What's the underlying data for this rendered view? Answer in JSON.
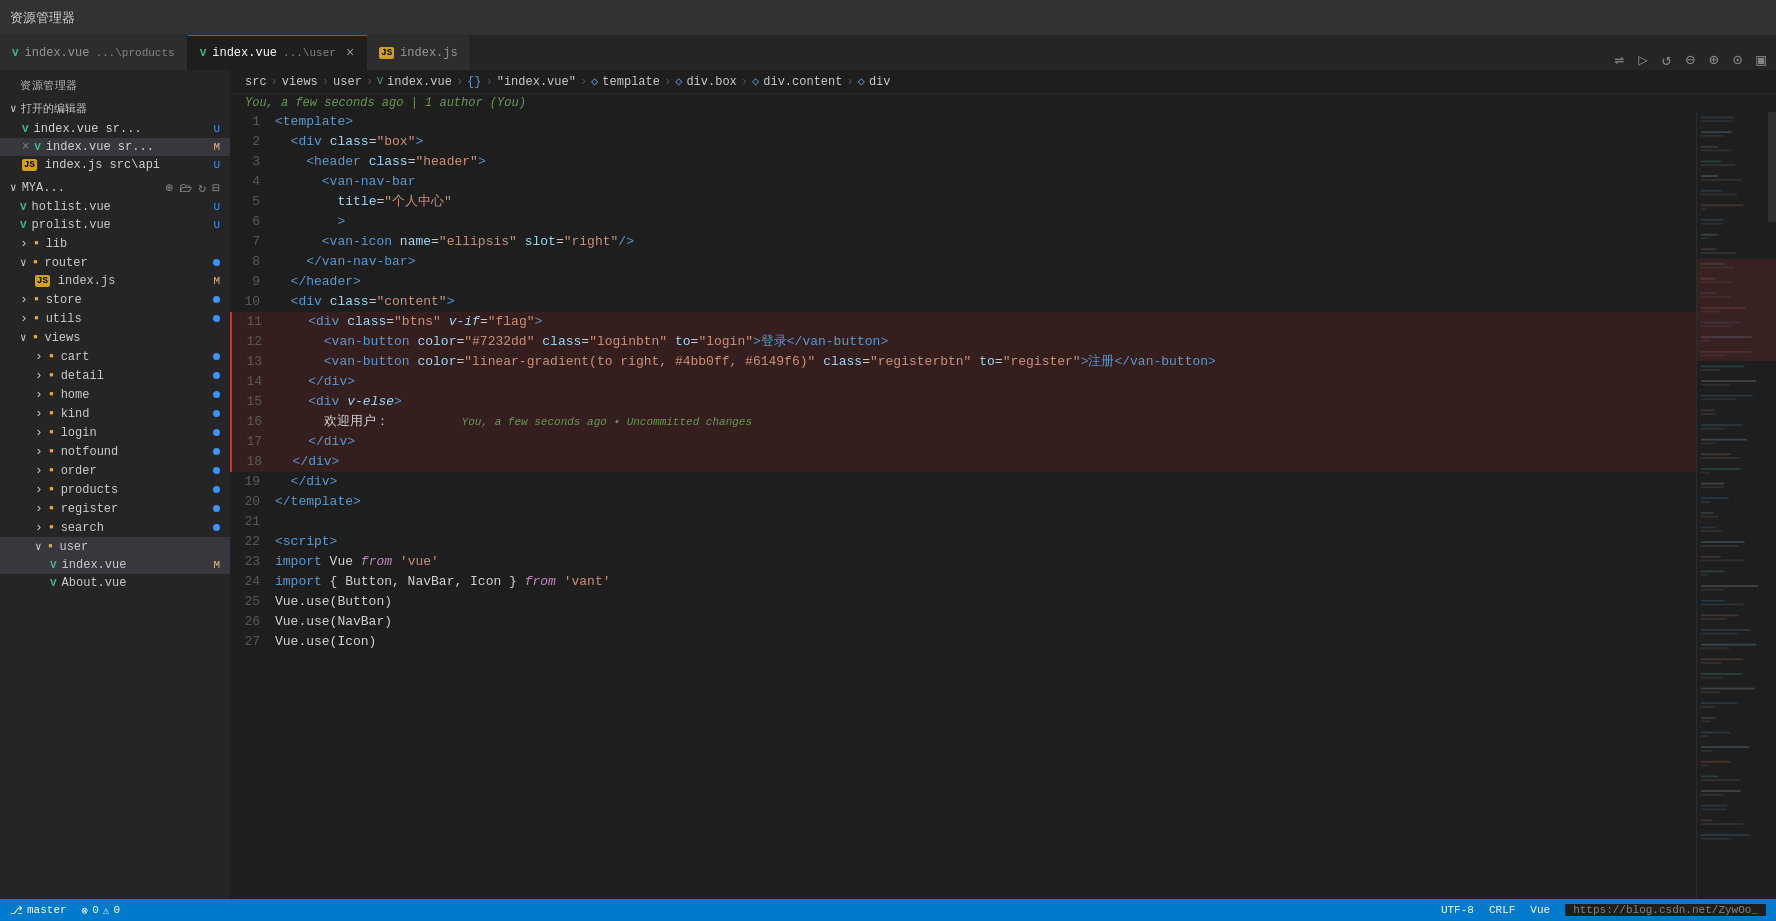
{
  "titlebar": {
    "text": "资源管理器"
  },
  "tabs": [
    {
      "id": "tab1",
      "icon": "vue",
      "filename": "index.vue",
      "path": "...\\products",
      "active": false,
      "modified": false,
      "closable": false
    },
    {
      "id": "tab2",
      "icon": "vue",
      "filename": "index.vue",
      "path": "...\\user",
      "active": true,
      "modified": true,
      "closable": true
    },
    {
      "id": "tab3",
      "icon": "js",
      "filename": "index.js",
      "path": "",
      "active": false,
      "modified": false,
      "closable": false
    }
  ],
  "toolbar": {
    "icons": [
      "split-horizontal",
      "play",
      "undo",
      "zoom-out",
      "zoom-in",
      "broadcast",
      "layout"
    ]
  },
  "breadcrumb": {
    "items": [
      "src",
      "views",
      "user",
      "index.vue",
      "{}",
      "\"index.vue\"",
      "template",
      "div.box",
      "div.content",
      "div"
    ]
  },
  "git_blame": {
    "text": "You, a few seconds ago | 1 author (You)"
  },
  "sidebar": {
    "title": "资源管理器",
    "section_open": "打开的编辑器",
    "open_files": [
      {
        "icon": "vue",
        "name": "index.vue",
        "path": "sr...",
        "badge": "U",
        "active": false
      },
      {
        "icon": "vue",
        "name": "index.vue",
        "path": "sr...",
        "badge": "M",
        "active": true,
        "hasX": true
      },
      {
        "icon": "js",
        "name": "index.js",
        "path": "src\\api",
        "badge": "U",
        "active": false
      }
    ],
    "project": {
      "name": "MYA...",
      "items": [
        {
          "type": "file",
          "icon": "vue",
          "name": "hotlist.vue",
          "badge": "U",
          "indent": 1
        },
        {
          "type": "file",
          "icon": "vue",
          "name": "prolist.vue",
          "badge": "U",
          "indent": 1
        },
        {
          "type": "folder",
          "name": "lib",
          "collapsed": true,
          "indent": 1
        },
        {
          "type": "folder",
          "name": "router",
          "collapsed": false,
          "indent": 1,
          "badge": "dot"
        },
        {
          "type": "file",
          "icon": "js",
          "name": "index.js",
          "badge": "M",
          "indent": 2
        },
        {
          "type": "folder",
          "name": "store",
          "collapsed": true,
          "indent": 1,
          "badge": "dot"
        },
        {
          "type": "folder",
          "name": "utils",
          "collapsed": true,
          "indent": 1,
          "badge": "dot"
        },
        {
          "type": "folder",
          "name": "views",
          "collapsed": false,
          "indent": 1
        },
        {
          "type": "folder",
          "name": "cart",
          "collapsed": true,
          "indent": 2,
          "badge": "dot"
        },
        {
          "type": "folder",
          "name": "detail",
          "collapsed": true,
          "indent": 2,
          "badge": "dot"
        },
        {
          "type": "folder",
          "name": "home",
          "collapsed": true,
          "indent": 2,
          "badge": "dot"
        },
        {
          "type": "folder",
          "name": "kind",
          "collapsed": true,
          "indent": 2,
          "badge": "dot"
        },
        {
          "type": "folder",
          "name": "login",
          "collapsed": true,
          "indent": 2,
          "badge": "dot"
        },
        {
          "type": "folder",
          "name": "notfound",
          "collapsed": true,
          "indent": 2,
          "badge": "dot"
        },
        {
          "type": "folder",
          "name": "order",
          "collapsed": true,
          "indent": 2,
          "badge": "dot"
        },
        {
          "type": "folder",
          "name": "products",
          "collapsed": true,
          "indent": 2,
          "badge": "dot"
        },
        {
          "type": "folder",
          "name": "register",
          "collapsed": true,
          "indent": 2,
          "badge": "dot"
        },
        {
          "type": "folder",
          "name": "search",
          "collapsed": true,
          "indent": 2,
          "badge": "dot"
        },
        {
          "type": "folder",
          "name": "user",
          "collapsed": false,
          "indent": 2,
          "selected": true
        },
        {
          "type": "file",
          "icon": "vue",
          "name": "index.vue",
          "badge": "M",
          "indent": 3
        },
        {
          "type": "file",
          "icon": "vue",
          "name": "About.vue",
          "badge": "",
          "indent": 3
        }
      ]
    }
  },
  "code_lines": [
    {
      "num": 1,
      "tokens": [
        {
          "t": "<template>",
          "c": "c-tag"
        }
      ]
    },
    {
      "num": 2,
      "tokens": [
        {
          "t": "  <div ",
          "c": "c-tag"
        },
        {
          "t": "class",
          "c": "c-attr"
        },
        {
          "t": "=",
          "c": "c-white"
        },
        {
          "t": "\"box\"",
          "c": "c-string"
        },
        {
          "t": ">",
          "c": "c-tag"
        }
      ]
    },
    {
      "num": 3,
      "tokens": [
        {
          "t": "    <header ",
          "c": "c-tag"
        },
        {
          "t": "class",
          "c": "c-attr"
        },
        {
          "t": "=",
          "c": "c-white"
        },
        {
          "t": "\"header\"",
          "c": "c-string"
        },
        {
          "t": ">",
          "c": "c-tag"
        }
      ]
    },
    {
      "num": 4,
      "tokens": [
        {
          "t": "      <van-nav-bar",
          "c": "c-tag"
        }
      ]
    },
    {
      "num": 5,
      "tokens": [
        {
          "t": "        ",
          "c": "c-white"
        },
        {
          "t": "title",
          "c": "c-attr"
        },
        {
          "t": "=",
          "c": "c-white"
        },
        {
          "t": "\"个人中心\"",
          "c": "c-string"
        }
      ]
    },
    {
      "num": 6,
      "tokens": [
        {
          "t": "        >",
          "c": "c-tag"
        }
      ]
    },
    {
      "num": 7,
      "tokens": [
        {
          "t": "      <van-icon ",
          "c": "c-tag"
        },
        {
          "t": "name",
          "c": "c-attr"
        },
        {
          "t": "=",
          "c": "c-white"
        },
        {
          "t": "\"ellipsis\"",
          "c": "c-string"
        },
        {
          "t": " ",
          "c": "c-white"
        },
        {
          "t": "slot",
          "c": "c-attr"
        },
        {
          "t": "=",
          "c": "c-white"
        },
        {
          "t": "\"right\"",
          "c": "c-string"
        },
        {
          "t": "/>",
          "c": "c-tag"
        }
      ]
    },
    {
      "num": 8,
      "tokens": [
        {
          "t": "    </van-nav-bar>",
          "c": "c-tag"
        }
      ]
    },
    {
      "num": 9,
      "tokens": [
        {
          "t": "  </header>",
          "c": "c-tag"
        }
      ]
    },
    {
      "num": 10,
      "tokens": [
        {
          "t": "  <div ",
          "c": "c-tag"
        },
        {
          "t": "class",
          "c": "c-attr"
        },
        {
          "t": "=",
          "c": "c-white"
        },
        {
          "t": "\"content\"",
          "c": "c-string"
        },
        {
          "t": ">",
          "c": "c-tag"
        }
      ]
    },
    {
      "num": 11,
      "tokens": [
        {
          "t": "    <div ",
          "c": "c-tag"
        },
        {
          "t": "class",
          "c": "c-attr"
        },
        {
          "t": "=",
          "c": "c-white"
        },
        {
          "t": "\"btns\"",
          "c": "c-string"
        },
        {
          "t": " ",
          "c": "c-white"
        },
        {
          "t": "v-if",
          "c": "c-directive"
        },
        {
          "t": "=",
          "c": "c-white"
        },
        {
          "t": "\"flag\"",
          "c": "c-string"
        },
        {
          "t": ">",
          "c": "c-tag"
        }
      ],
      "range": true
    },
    {
      "num": 12,
      "tokens": [
        {
          "t": "      <van-button ",
          "c": "c-tag"
        },
        {
          "t": "color",
          "c": "c-attr"
        },
        {
          "t": "=",
          "c": "c-white"
        },
        {
          "t": "\"#7232dd\"",
          "c": "c-string"
        },
        {
          "t": " ",
          "c": "c-white"
        },
        {
          "t": "class",
          "c": "c-attr"
        },
        {
          "t": "=",
          "c": "c-white"
        },
        {
          "t": "\"loginbtn\"",
          "c": "c-string"
        },
        {
          "t": " ",
          "c": "c-white"
        },
        {
          "t": "to",
          "c": "c-attr"
        },
        {
          "t": "=",
          "c": "c-white"
        },
        {
          "t": "\"login\"",
          "c": "c-string"
        },
        {
          "t": ">登录</van-button>",
          "c": "c-tag"
        }
      ],
      "range": true
    },
    {
      "num": 13,
      "tokens": [
        {
          "t": "      <van-button ",
          "c": "c-tag"
        },
        {
          "t": "color",
          "c": "c-attr"
        },
        {
          "t": "=",
          "c": "c-white"
        },
        {
          "t": "\"linear-gradient(to right, #4bb0ff, #6149f6)\"",
          "c": "c-string"
        },
        {
          "t": " ",
          "c": "c-white"
        },
        {
          "t": "class",
          "c": "c-attr"
        },
        {
          "t": "=",
          "c": "c-white"
        },
        {
          "t": "\"registerbtn\"",
          "c": "c-string"
        },
        {
          "t": " ",
          "c": "c-white"
        },
        {
          "t": "to",
          "c": "c-attr"
        },
        {
          "t": "=",
          "c": "c-white"
        },
        {
          "t": "\"register\"",
          "c": "c-string"
        },
        {
          "t": ">注册</",
          "c": "c-tag"
        },
        {
          "t": "van-button",
          "c": "c-tag"
        }
      ],
      "range": true
    },
    {
      "num": 14,
      "tokens": [
        {
          "t": "    </div>",
          "c": "c-tag"
        }
      ],
      "range": true
    },
    {
      "num": 15,
      "tokens": [
        {
          "t": "    <div ",
          "c": "c-tag"
        },
        {
          "t": "v-else",
          "c": "c-directive"
        },
        {
          "t": ">",
          "c": "c-tag"
        }
      ],
      "range": true
    },
    {
      "num": 16,
      "tokens": [
        {
          "t": "      欢迎用户：",
          "c": "c-white"
        },
        {
          "t": "        You, a few seconds ago • Uncommitted changes",
          "c": "inline-blame"
        }
      ],
      "range": true
    },
    {
      "num": 17,
      "tokens": [
        {
          "t": "    </div>",
          "c": "c-tag"
        }
      ],
      "range": true
    },
    {
      "num": 18,
      "tokens": [
        {
          "t": "  </div>",
          "c": "c-tag"
        }
      ],
      "range": true
    },
    {
      "num": 19,
      "tokens": [
        {
          "t": "  </div>",
          "c": "c-tag"
        }
      ]
    },
    {
      "num": 20,
      "tokens": [
        {
          "t": "</template>",
          "c": "c-tag"
        }
      ]
    },
    {
      "num": 21,
      "tokens": []
    },
    {
      "num": 22,
      "tokens": [
        {
          "t": "<script>",
          "c": "c-tag"
        }
      ]
    },
    {
      "num": 23,
      "tokens": [
        {
          "t": "import ",
          "c": "c-keyword"
        },
        {
          "t": "Vue ",
          "c": "c-white"
        },
        {
          "t": "from",
          "c": "c-import-from"
        },
        {
          "t": " 'vue'",
          "c": "c-import-str"
        }
      ]
    },
    {
      "num": 24,
      "tokens": [
        {
          "t": "import ",
          "c": "c-keyword"
        },
        {
          "t": "{ Button, NavBar, Icon } ",
          "c": "c-white"
        },
        {
          "t": "from",
          "c": "c-import-from"
        },
        {
          "t": " 'vant'",
          "c": "c-import-str"
        }
      ]
    },
    {
      "num": 25,
      "tokens": [
        {
          "t": "Vue.use(Button)",
          "c": "c-white"
        }
      ]
    },
    {
      "num": 26,
      "tokens": [
        {
          "t": "Vue.use(NavBar)",
          "c": "c-white"
        }
      ]
    },
    {
      "num": 27,
      "tokens": [
        {
          "t": "Vue.use(Icon)",
          "c": "c-white"
        }
      ]
    }
  ],
  "status_bar": {
    "git_branch": "master",
    "errors": "0",
    "warnings": "0",
    "encoding": "UTF-8",
    "line_ending": "CRLF",
    "language": "Vue",
    "url": "https://blog.csdn.net/ZywOo_"
  }
}
